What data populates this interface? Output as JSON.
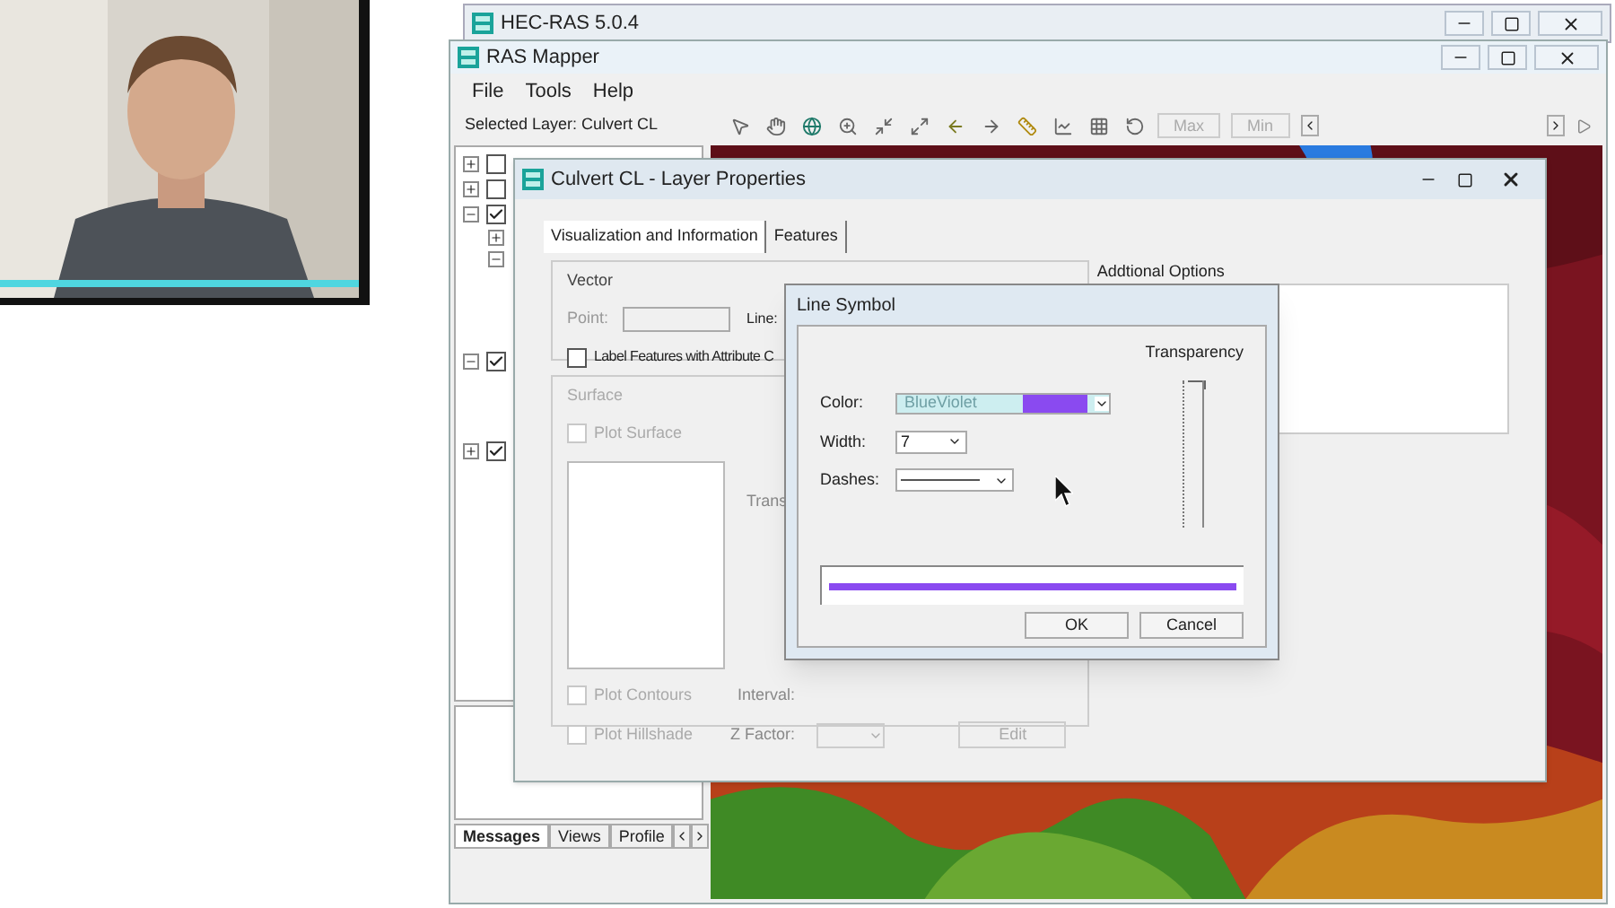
{
  "back_window": {
    "title": "HEC-RAS 5.0.4"
  },
  "mapper": {
    "title": "RAS Mapper",
    "menu": [
      "File",
      "Tools",
      "Help"
    ],
    "selected_layer": "Selected Layer: Culvert CL",
    "buttons": [
      "Max",
      "Min"
    ],
    "tree": [
      {
        "checked": false,
        "expanded": false
      },
      {
        "checked": false,
        "expanded": false
      },
      {
        "checked": true,
        "expanded": true,
        "children": [
          {
            "expanded": false
          },
          {
            "expanded": true
          }
        ]
      },
      {
        "checked": true,
        "expanded": true
      },
      {
        "checked": true,
        "expanded": false
      }
    ],
    "bottom_tabs": [
      {
        "label": "Messages",
        "selected": true
      },
      {
        "label": "Views",
        "selected": false
      },
      {
        "label": "Profile",
        "selected": false
      }
    ]
  },
  "layer_properties": {
    "title": "Culvert CL - Layer Properties",
    "tabs": [
      {
        "label": "Visualization and Information",
        "selected": true
      },
      {
        "label": "Features",
        "selected": false
      }
    ],
    "vector": {
      "title": "Vector",
      "point": "Point:",
      "line": "Line:",
      "label_features": {
        "label": "Label Features with Attribute C",
        "checked": false
      }
    },
    "surface": {
      "title": "Surface",
      "plot_surface": {
        "label": "Plot Surface",
        "checked": false
      },
      "transparency": "Trans",
      "plot_contours": {
        "label": "Plot Contours",
        "checked": false
      },
      "interval": "Interval:",
      "plot_hillshade": {
        "label": "Plot Hillshade",
        "checked": false
      },
      "z_factor": "Z Factor:",
      "edit": "Edit"
    },
    "additional_options": {
      "title": "Addtional Options"
    }
  },
  "line_symbol": {
    "title": "Line Symbol",
    "color_label": "Color:",
    "color_value": "BlueViolet",
    "color": "#8a4af0",
    "width_label": "Width:",
    "width_value": "7",
    "dashes_label": "Dashes:",
    "transparency_label": "Transparency",
    "transparency": {
      "level": 1
    },
    "buttons": [
      "OK",
      "Cancel"
    ]
  }
}
